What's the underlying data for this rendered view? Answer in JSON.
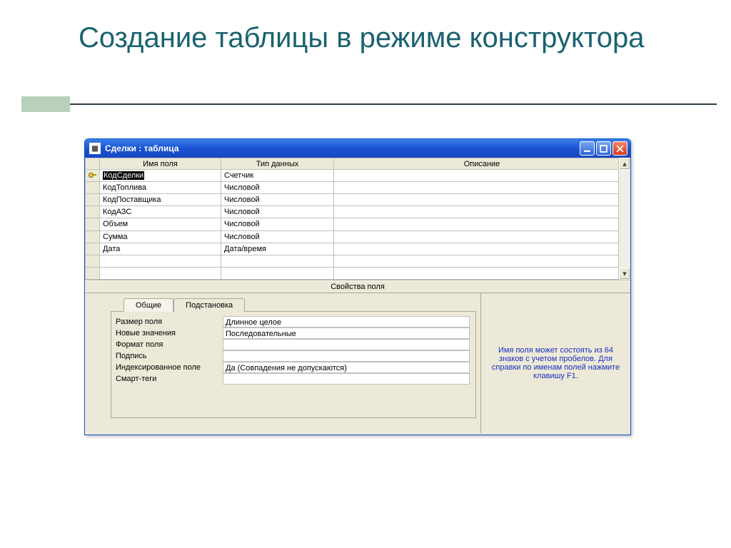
{
  "slide": {
    "title": "Создание таблицы в режиме конструктора"
  },
  "window": {
    "title": "Сделки : таблица",
    "buttons": {
      "min": "_",
      "max": "❐",
      "close": "✕"
    }
  },
  "grid": {
    "headers": {
      "name": "Имя поля",
      "type": "Тип данных",
      "desc": "Описание"
    },
    "rows": [
      {
        "key": true,
        "name": "КодСделки",
        "type": "Счетчик",
        "desc": ""
      },
      {
        "key": false,
        "name": "КодТоплива",
        "type": "Числовой",
        "desc": ""
      },
      {
        "key": false,
        "name": "КодПоставщика",
        "type": "Числовой",
        "desc": ""
      },
      {
        "key": false,
        "name": "КодАЗС",
        "type": "Числовой",
        "desc": ""
      },
      {
        "key": false,
        "name": "Объем",
        "type": "Числовой",
        "desc": ""
      },
      {
        "key": false,
        "name": "Сумма",
        "type": "Числовой",
        "desc": ""
      },
      {
        "key": false,
        "name": "Дата",
        "type": "Дата/время",
        "desc": ""
      }
    ]
  },
  "props": {
    "separator": "Свойства поля",
    "tabs": {
      "general": "Общие",
      "lookup": "Подстановка"
    },
    "labels": {
      "size": "Размер поля",
      "new_vals": "Новые значения",
      "format": "Формат поля",
      "caption": "Подпись",
      "indexed": "Индексированное поле",
      "smart": "Смарт-теги"
    },
    "values": {
      "size": "Длинное целое",
      "new_vals": "Последовательные",
      "format": "",
      "caption": "",
      "indexed": "Да (Совпадения не допускаются)",
      "smart": ""
    },
    "help": "Имя поля может состоять из 64 знаков с учетом пробелов.  Для справки по именам полей нажмите клавишу F1."
  }
}
